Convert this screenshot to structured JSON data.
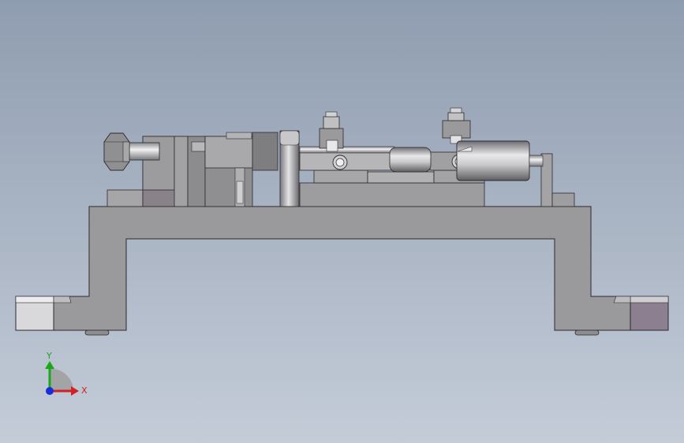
{
  "viewport": {
    "background_top": "#8f9db0",
    "background_bottom": "#c4ccd8"
  },
  "triad": {
    "x_label": "X",
    "y_label": "Y",
    "x_color": "#d42020",
    "y_color": "#18a818",
    "z_color": "#1a2bd8"
  }
}
